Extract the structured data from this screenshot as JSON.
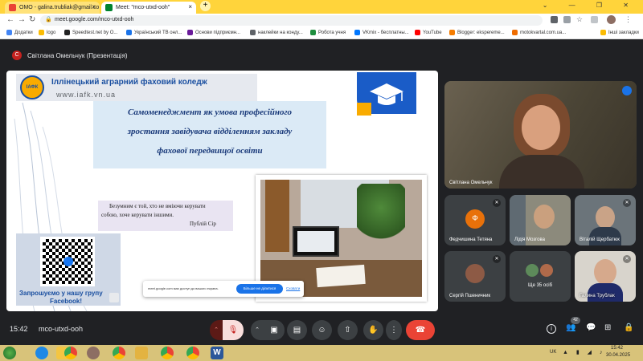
{
  "browser": {
    "tabs": [
      {
        "label": "ОМО - galina.trubliak@gmail.co",
        "close": "×"
      },
      {
        "label": "Meet: \"mco-utxd-ooh\"",
        "close": "×"
      }
    ],
    "new_tab": "+",
    "url": "meet.google.com/mco-utxd-ooh",
    "bookmarks": [
      "Додатки",
      "logo",
      "Speedtest.net by O...",
      "Український ТВ онл...",
      "Основи підприємн...",
      "наклейки на конду...",
      "Робота учня",
      "VKmix - бесплатны...",
      "YouTube",
      "Blogger: eksperemе...",
      "motokvartal.com.ua..."
    ],
    "bookmarks_other": "Інші закладки"
  },
  "meet": {
    "presenter_initial": "С",
    "presenter_label": "Світлана Омельчук (Презентація)",
    "time": "15:42",
    "meeting_code": "mco-utxd-ooh",
    "participant_count": "42",
    "participants": [
      {
        "name": "Світлана Омельчук"
      },
      {
        "name": "Федчишина Тетяна",
        "initial": "Ф"
      },
      {
        "name": "Лідія Мозгова"
      },
      {
        "name": "Віталій Щербатюк"
      },
      {
        "name": "Сергій Пшеничник"
      },
      {
        "name": "Ще 35 осіб"
      },
      {
        "name": "Галина Трублак"
      }
    ],
    "share_notice": {
      "text": "meet.google.com має доступ до вашого екрана.",
      "stop": "Більше не ділитися",
      "hide": "Сховати"
    }
  },
  "slide": {
    "college_name": "Іллінецький аграрний фаховий коледж",
    "website": "www.iafk.vn.ua",
    "logo_text": "ІАФК",
    "title_lines": [
      "Самоменеджмент як умова професійного",
      "зростання завідувача відділенням закладу",
      "фахової передвищої освіти"
    ],
    "quote_lines": [
      "Безумним є той, хто не вміючи керувати",
      "собою, хоче керувати іншими."
    ],
    "quote_author": "Публій Сір",
    "facebook_lines": [
      "Запрошуємо у нашу групу",
      "Facebook!"
    ]
  },
  "taskbar": {
    "lang": "UK",
    "time": "15:42",
    "date": "30.04.2025"
  },
  "colors": {
    "chrome_tab_bar": "#ffd43b",
    "meet_bg": "#202124",
    "end_call": "#ea4335",
    "stop_share": "#1a73e8",
    "tile_orange": "#e8710a"
  }
}
